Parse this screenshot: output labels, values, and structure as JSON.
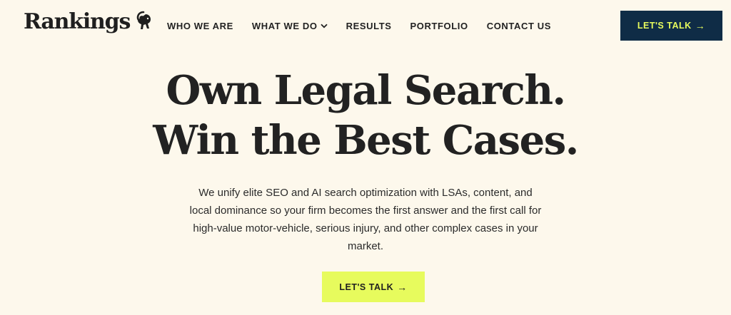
{
  "brand": {
    "name": "Rankings",
    "logo_icon": "ram-icon"
  },
  "nav": {
    "items": [
      {
        "label": "WHO WE ARE"
      },
      {
        "label": "WHAT WE DO",
        "has_dropdown": true
      },
      {
        "label": "RESULTS"
      },
      {
        "label": "PORTFOLIO"
      },
      {
        "label": "CONTACT US"
      }
    ]
  },
  "header_cta": {
    "label": "LET'S TALK",
    "arrow": "→"
  },
  "hero": {
    "title_line1": "Own Legal Search.",
    "title_line2": "Win the Best Cases.",
    "subtitle": "We unify elite SEO and AI search optimization with LSAs, content, and local dominance so your firm becomes the first answer and the first call for high-value motor-vehicle, serious injury, and other complex cases in your market.",
    "cta": {
      "label": "LET'S TALK",
      "arrow": "→"
    }
  },
  "colors": {
    "background": "#fdf8ec",
    "navy": "#0f2c46",
    "lime": "#e7fb5d",
    "text": "#1f1f1f"
  }
}
